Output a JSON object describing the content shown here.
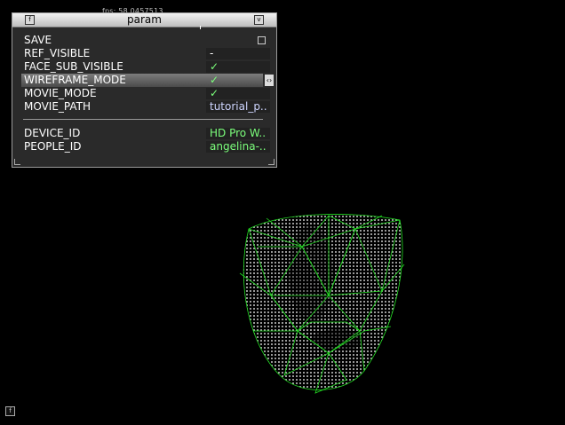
{
  "overlay": {
    "fps_text": "fps: 58.0457513"
  },
  "panel": {
    "title": "param",
    "rows": [
      {
        "label": "SAVE",
        "type": "checkbox",
        "value": ""
      },
      {
        "label": "REF_VISIBLE",
        "type": "text",
        "value": "-"
      },
      {
        "label": "FACE_SUB_VISIBLE",
        "type": "check",
        "value": "✓"
      },
      {
        "label": "WIREFRAME_MODE",
        "type": "check",
        "value": "✓",
        "highlighted": true
      },
      {
        "label": "MOVIE_MODE",
        "type": "check",
        "value": "✓"
      },
      {
        "label": "MOVIE_PATH",
        "type": "text",
        "value": "tutorial_p.."
      },
      {
        "label": "DEVICE_ID",
        "type": "text",
        "value": "HD Pro W.."
      },
      {
        "label": "PEOPLE_ID",
        "type": "text",
        "value": "angelina-.."
      }
    ]
  },
  "scene": {
    "mesh_color": "#22dd22",
    "background": "#000000"
  }
}
